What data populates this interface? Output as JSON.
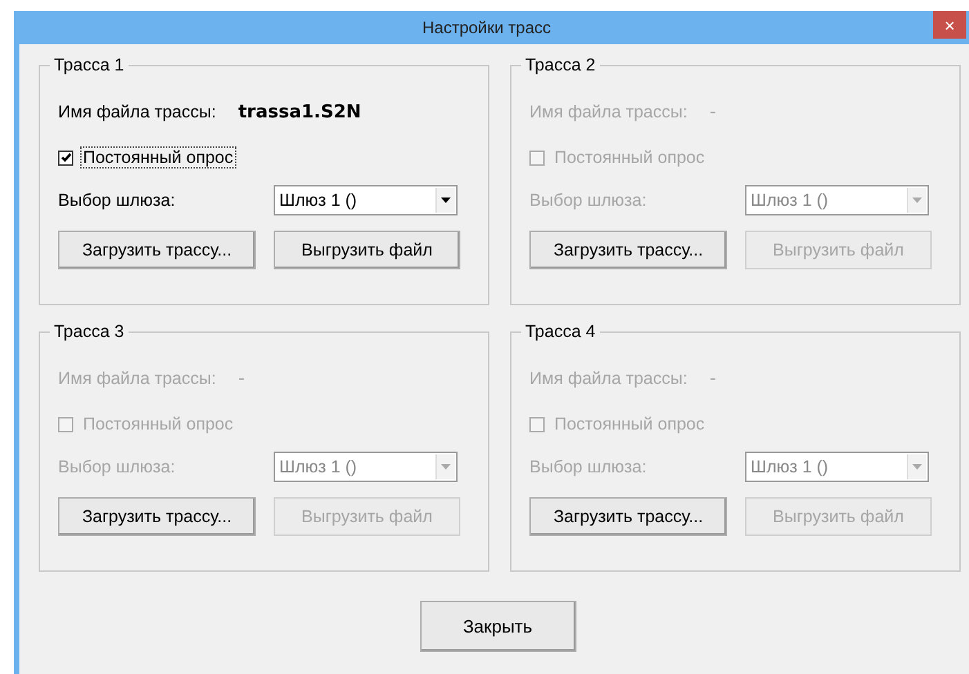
{
  "window": {
    "title": "Настройки трасс",
    "close": "×"
  },
  "groups": [
    {
      "title": "Трасса 1",
      "disabled": false,
      "file_label": "Имя файла трассы:",
      "file_name": "trassa1.S2N",
      "polling": {
        "label": "Постоянный опрос",
        "checked": true,
        "focused": true
      },
      "gateway_label": "Выбор шлюза:",
      "gateway": "Шлюз 1 ()",
      "buttons": [
        {
          "label": "Загрузить трассу...",
          "disabled": false
        },
        {
          "label": "Выгрузить файл",
          "disabled": false
        }
      ]
    },
    {
      "title": "Трасса 2",
      "disabled": true,
      "file_label": "Имя файла трассы:",
      "file_name": "-",
      "polling": {
        "label": "Постоянный опрос",
        "checked": false,
        "focused": false
      },
      "gateway_label": "Выбор шлюза:",
      "gateway": "Шлюз 1 ()",
      "buttons": [
        {
          "label": "Загрузить трассу...",
          "disabled": false
        },
        {
          "label": "Выгрузить файл",
          "disabled": true
        }
      ]
    },
    {
      "title": "Трасса 3",
      "disabled": true,
      "file_label": "Имя файла трассы:",
      "file_name": "-",
      "polling": {
        "label": "Постоянный опрос",
        "checked": false,
        "focused": false
      },
      "gateway_label": "Выбор шлюза:",
      "gateway": "Шлюз 1 ()",
      "buttons": [
        {
          "label": "Загрузить трассу...",
          "disabled": false
        },
        {
          "label": "Выгрузить файл",
          "disabled": true
        }
      ]
    },
    {
      "title": "Трасса 4",
      "disabled": true,
      "file_label": "Имя файла трассы:",
      "file_name": "-",
      "polling": {
        "label": "Постоянный опрос",
        "checked": false,
        "focused": false
      },
      "gateway_label": "Выбор шлюза:",
      "gateway": "Шлюз 1 ()",
      "buttons": [
        {
          "label": "Загрузить трассу...",
          "disabled": false
        },
        {
          "label": "Выгрузить файл",
          "disabled": true
        }
      ]
    }
  ],
  "close_button": "Закрыть"
}
